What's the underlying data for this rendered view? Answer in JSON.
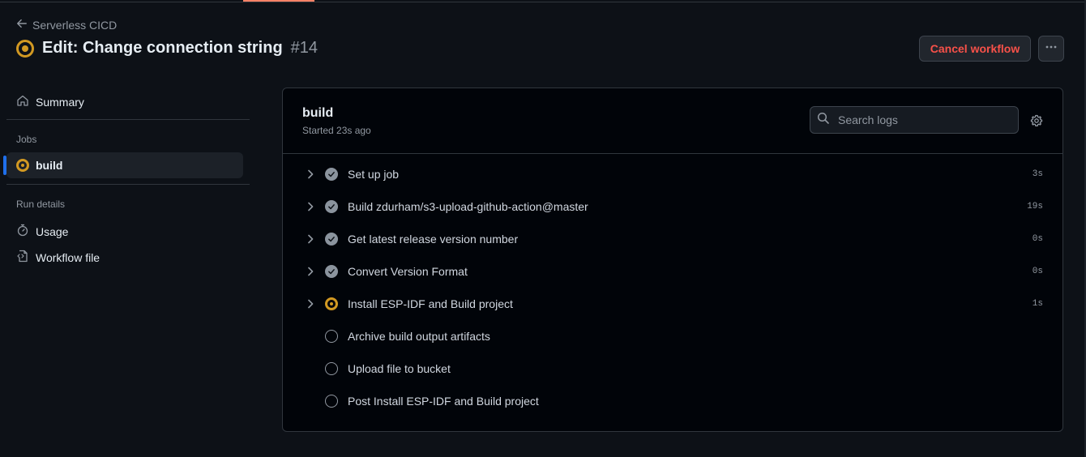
{
  "breadcrumb": {
    "label": "Serverless CICD"
  },
  "run": {
    "title": "Edit: Change connection string",
    "number": "#14"
  },
  "actions": {
    "cancel_label": "Cancel workflow"
  },
  "sidebar": {
    "summary_label": "Summary",
    "jobs_heading": "Jobs",
    "job_label": "build",
    "run_details_heading": "Run details",
    "usage_label": "Usage",
    "workflow_file_label": "Workflow file"
  },
  "job": {
    "name": "build",
    "started": "Started 23s ago",
    "search_placeholder": "Search logs",
    "steps": [
      {
        "name": "Set up job",
        "status": "success",
        "duration": "3s"
      },
      {
        "name": "Build zdurham/s3-upload-github-action@master",
        "status": "success",
        "duration": "19s"
      },
      {
        "name": "Get latest release version number",
        "status": "success",
        "duration": "0s"
      },
      {
        "name": "Convert Version Format",
        "status": "success",
        "duration": "0s"
      },
      {
        "name": "Install ESP-IDF and Build project",
        "status": "in_progress",
        "duration": "1s"
      },
      {
        "name": "Archive build output artifacts",
        "status": "queued",
        "duration": ""
      },
      {
        "name": "Upload file to bucket",
        "status": "queued",
        "duration": ""
      },
      {
        "name": "Post Install ESP-IDF and Build project",
        "status": "queued",
        "duration": ""
      }
    ]
  },
  "colors": {
    "running": "#d29922",
    "danger": "#f85149",
    "accent": "#1f6feb",
    "success_icon": "#8b949e"
  },
  "icons": [
    "arrow-left-icon",
    "running-status-icon",
    "kebab-horizontal-icon",
    "home-icon",
    "stopwatch-icon",
    "file-code-icon",
    "search-icon",
    "gear-icon",
    "chevron-right-icon",
    "check-circle-icon",
    "circle-icon"
  ]
}
